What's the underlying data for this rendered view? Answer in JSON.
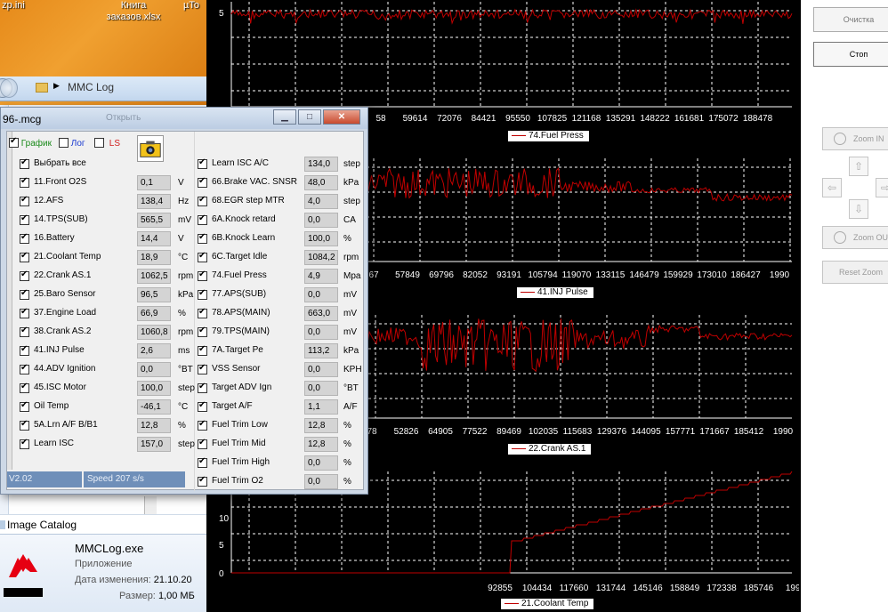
{
  "desktop": {
    "icons": [
      "zp.ini",
      "Книга заказов.xlsx",
      "µTo"
    ]
  },
  "explorer": {
    "address": "MMC Log",
    "catalog_label": "Image Catalog",
    "file": {
      "name": "MMCLog.exe",
      "type": "Приложение",
      "modified_label": "Дата изменения:",
      "modified_value": "21.10.20",
      "size_label": "Размер:",
      "size_value": "1,00 МБ"
    },
    "logo_text": "MITSUBISHI"
  },
  "dialog": {
    "title": "96-.mcg",
    "faded_title_text": "Открыть",
    "header": {
      "graph_label": "График",
      "log_label": "Лог",
      "ls_label": "LS",
      "select_all": "Выбрать все"
    },
    "left_params": [
      {
        "name": "11.Front O2S",
        "value": "0,1",
        "unit": "V"
      },
      {
        "name": "12.AFS",
        "value": "138,4",
        "unit": "Hz"
      },
      {
        "name": "14.TPS(SUB)",
        "value": "565,5",
        "unit": "mV"
      },
      {
        "name": "16.Battery",
        "value": "14,4",
        "unit": "V"
      },
      {
        "name": "21.Coolant Temp",
        "value": "18,9",
        "unit": "°C"
      },
      {
        "name": "22.Crank AS.1",
        "value": "1062,5",
        "unit": "rpm"
      },
      {
        "name": "25.Baro Sensor",
        "value": "96,5",
        "unit": "kPa"
      },
      {
        "name": "37.Engine Load",
        "value": "66,9",
        "unit": "%"
      },
      {
        "name": "38.Crank AS.2",
        "value": "1060,8",
        "unit": "rpm"
      },
      {
        "name": "41.INJ Pulse",
        "value": "2,6",
        "unit": "ms"
      },
      {
        "name": "44.ADV Ignition",
        "value": "0,0",
        "unit": "°BT"
      },
      {
        "name": "45.ISC Motor",
        "value": "100,0",
        "unit": "step"
      },
      {
        "name": "Oil Temp",
        "value": "-46,1",
        "unit": "°C"
      },
      {
        "name": "5A.Lrn A/F B/B1",
        "value": "12,8",
        "unit": "%"
      },
      {
        "name": "Learn ISC",
        "value": "157,0",
        "unit": "step"
      }
    ],
    "right_params": [
      {
        "name": "Learn ISC A/C",
        "value": "134,0",
        "unit": "step"
      },
      {
        "name": "66.Brake VAC. SNSR",
        "value": "48,0",
        "unit": "kPa"
      },
      {
        "name": "68.EGR step MTR",
        "value": "4,0",
        "unit": "step"
      },
      {
        "name": "6A.Knock retard",
        "value": "0,0",
        "unit": "CA"
      },
      {
        "name": "6B.Knock Learn",
        "value": "100,0",
        "unit": "%"
      },
      {
        "name": "6C.Target Idle",
        "value": "1084,2",
        "unit": "rpm"
      },
      {
        "name": "74.Fuel Press",
        "value": "4,9",
        "unit": "Mpa"
      },
      {
        "name": "77.APS(SUB)",
        "value": "0,0",
        "unit": "mV"
      },
      {
        "name": "78.APS(MAIN)",
        "value": "663,0",
        "unit": "mV"
      },
      {
        "name": "79.TPS(MAIN)",
        "value": "0,0",
        "unit": "mV"
      },
      {
        "name": "7A.Target Pe",
        "value": "113,2",
        "unit": "kPa"
      },
      {
        "name": "VSS Sensor",
        "value": "0,0",
        "unit": "KPH"
      },
      {
        "name": "Target ADV Ign",
        "value": "0,0",
        "unit": "°BT"
      },
      {
        "name": "Target A/F",
        "value": "1,1",
        "unit": "A/F"
      },
      {
        "name": "Fuel Trim Low",
        "value": "12,8",
        "unit": "%"
      },
      {
        "name": "Fuel Trim Mid",
        "value": "12,8",
        "unit": "%"
      },
      {
        "name": "Fuel Trim High",
        "value": "0,0",
        "unit": "%"
      },
      {
        "name": "Fuel Trim O2",
        "value": "0,0",
        "unit": "%"
      }
    ],
    "status_version": "V2.02",
    "status_speed": "Speed 207 s/s"
  },
  "chart_data": [
    {
      "type": "line",
      "series": [
        {
          "name": "74.Fuel Press"
        }
      ],
      "y_tick_labels": [
        "5"
      ],
      "x_tick_labels": [
        "58",
        "59614",
        "72076",
        "84421",
        "95550",
        "107825",
        "121168",
        "135291",
        "148222",
        "161681",
        "175072",
        "188478"
      ],
      "grid": true,
      "description_level": "flat near 5 with noise"
    },
    {
      "type": "line",
      "series": [
        {
          "name": "41.INJ Pulse"
        }
      ],
      "x_tick_labels": [
        "67",
        "57849",
        "69796",
        "82052",
        "93191",
        "105794",
        "119070",
        "133115",
        "146479",
        "159929",
        "173010",
        "186427",
        "1990"
      ],
      "grid": true
    },
    {
      "type": "line",
      "series": [
        {
          "name": "22.Crank AS.1"
        }
      ],
      "x_tick_labels": [
        "78",
        "52826",
        "64905",
        "77522",
        "89469",
        "102035",
        "115683",
        "129376",
        "144095",
        "157771",
        "171667",
        "185412",
        "1990"
      ],
      "grid": true
    },
    {
      "type": "line",
      "series": [
        {
          "name": "21.Coolant Temp"
        }
      ],
      "y_tick_labels": [
        "0",
        "5",
        "10"
      ],
      "x_tick_labels": [
        "92855",
        "104434",
        "117660",
        "131744",
        "145146",
        "158849",
        "172338",
        "185746",
        "1990"
      ],
      "values_note": "0 until ~92855, then jumps to ~6 and rises steadily to ~19",
      "grid": true
    }
  ],
  "right_panel": {
    "clear_label": "Очистка",
    "stop_label": "Стоп",
    "zoom_in_label": "Zoom IN",
    "zoom_out_label": "Zoom OUT",
    "reset_zoom_label": "Reset Zoom",
    "colors": {
      "trace": "#c00000",
      "grid": "#ffffff",
      "background": "#000000"
    }
  }
}
